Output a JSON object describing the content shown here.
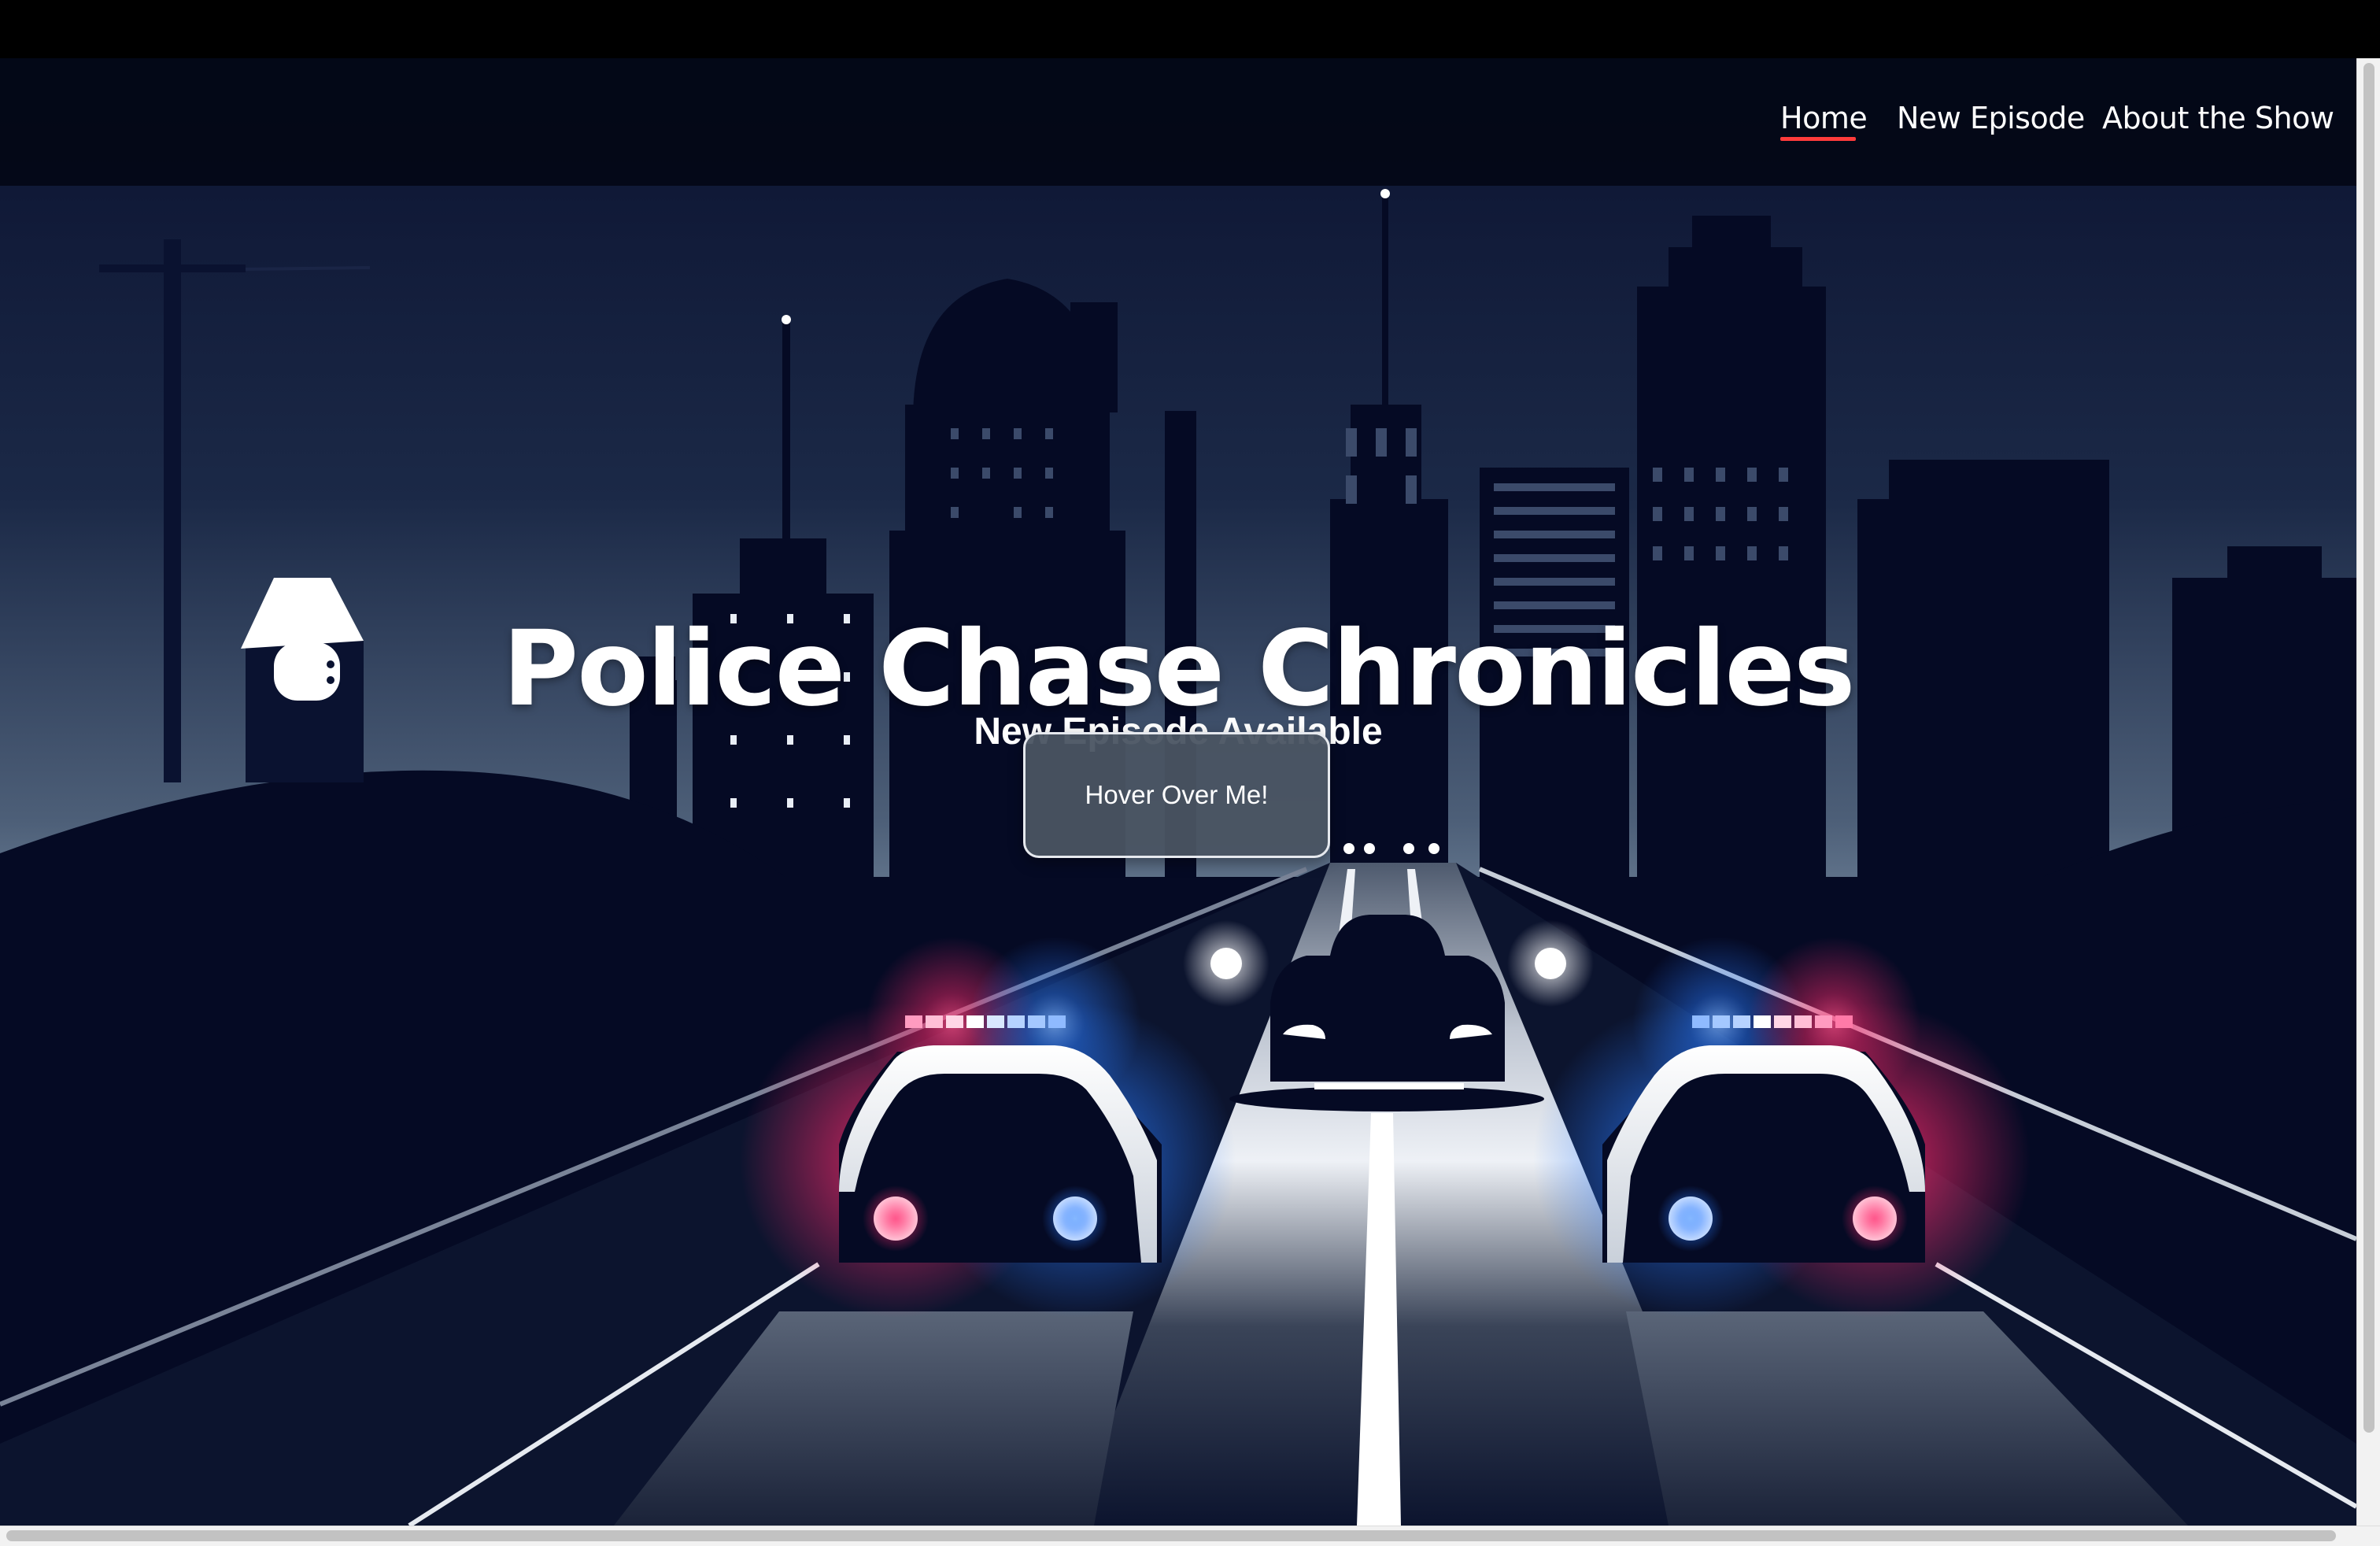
{
  "nav": {
    "items": [
      {
        "label": "Home",
        "active": true
      },
      {
        "label": "New Episode",
        "active": false
      },
      {
        "label": "About the Show",
        "active": false
      }
    ]
  },
  "hero": {
    "title": "Police Chase Chronicles",
    "subtitle": "New Episode Available",
    "button_label": "Hover Over Me!"
  },
  "colors": {
    "sky_dark": "#0a1028",
    "sky_horizon": "#5d6f85",
    "silhouette": "#050a24",
    "road": "#1c2436",
    "siren_red": "#ff2a6d",
    "siren_blue": "#2a7bff",
    "nav_active_underline": "#ff3b3b",
    "button_bg": "#4a5462"
  },
  "icons": {
    "hero_illustration": "night-city-police-chase-illustration"
  }
}
